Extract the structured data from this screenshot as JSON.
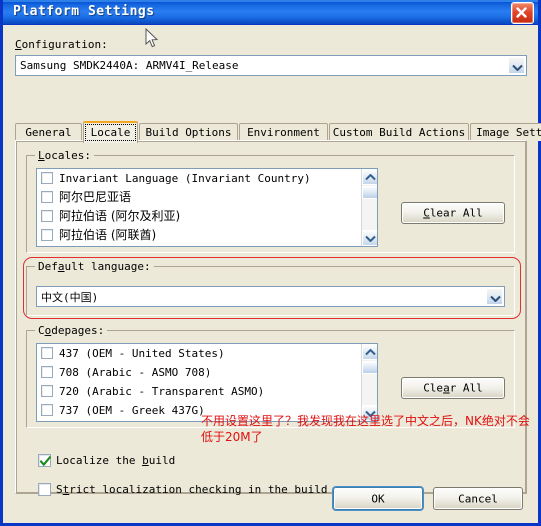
{
  "window": {
    "title": "Platform Settings",
    "close_label": "Close"
  },
  "configuration": {
    "label": "Configuration:",
    "value": "Samsung SMDK2440A: ARMV4I_Release"
  },
  "tabs": [
    {
      "label": "General",
      "selected": false
    },
    {
      "label": "Locale",
      "selected": true
    },
    {
      "label": "Build Options",
      "selected": false
    },
    {
      "label": "Environment",
      "selected": false
    },
    {
      "label": "Custom Build Actions",
      "selected": false
    },
    {
      "label": "Image Settings",
      "selected": false
    }
  ],
  "locales": {
    "group_label": "Locales:",
    "items": [
      {
        "label": "Invariant Language (Invariant Country)",
        "checked": false,
        "cjk": false
      },
      {
        "label": "阿尔巴尼亚语",
        "checked": false,
        "cjk": true
      },
      {
        "label": "阿拉伯语 (阿尔及利亚)",
        "checked": false,
        "cjk": true
      },
      {
        "label": "阿拉伯语 (阿联酋)",
        "checked": false,
        "cjk": true
      }
    ],
    "clear_all_label": "Clear All"
  },
  "default_language": {
    "group_label": "Default language:",
    "value": "中文(中国)"
  },
  "codepages": {
    "group_label": "Codepages:",
    "items": [
      {
        "label": "437   (OEM - United States)",
        "checked": false
      },
      {
        "label": "708   (Arabic - ASMO 708)",
        "checked": false
      },
      {
        "label": "720   (Arabic - Transparent ASMO)",
        "checked": false
      },
      {
        "label": "737   (OEM - Greek 437G)",
        "checked": false
      }
    ],
    "clear_all_label": "Clear All"
  },
  "annotation": {
    "text": "不用设置这里了？我发现我在这里选了中文之后，NK绝对不会低于20M了",
    "color": "#E01010"
  },
  "checkboxes": [
    {
      "label": "Localize the build",
      "checked": true
    },
    {
      "label": "Strict localization checking in the build",
      "checked": false
    }
  ],
  "footer": {
    "ok_label": "OK",
    "cancel_label": "Cancel"
  },
  "colors": {
    "dialog_bg": "#ECE9D8",
    "title_blue": "#0A36C8",
    "accent_tab": "#F5A623",
    "annotation_red": "#E01010"
  }
}
